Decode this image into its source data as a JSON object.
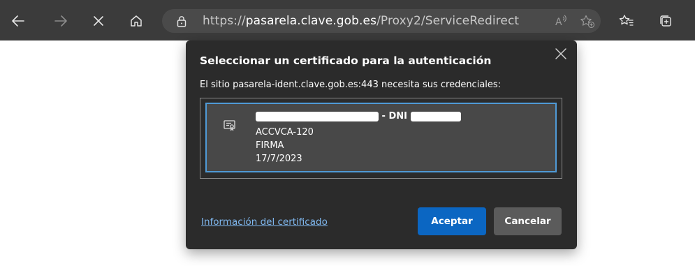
{
  "browser": {
    "url_prefix": "https://",
    "url_host": "pasarela.clave.gob.es",
    "url_path": "/Proxy2/ServiceRedirect",
    "icons": {
      "back": "back-arrow-icon",
      "forward": "forward-arrow-icon",
      "stop": "close-icon",
      "home": "home-icon",
      "lock": "lock-icon",
      "read_aloud": "read-aloud-icon",
      "add_favorite": "add-favorite-icon",
      "favorites": "favorites-icon",
      "collections": "collections-icon"
    }
  },
  "dialog": {
    "title": "Seleccionar un certificado para la autenticación",
    "subtitle": "El sitio pasarela-ident.clave.gob.es:443 necesita sus credenciales:",
    "certificate": {
      "name_visible": "- DNI",
      "issuer": "ACCVCA-120",
      "purpose": "FIRMA",
      "date": "17/7/2023"
    },
    "info_link": "Información del certificado",
    "accept_label": "Aceptar",
    "cancel_label": "Cancelar"
  },
  "colors": {
    "toolbar": "#3b3b3b",
    "dialog": "#2b2b2b",
    "accent": "#0b66c2",
    "selection_border": "#4f9ad6",
    "link": "#7fb7ee"
  }
}
